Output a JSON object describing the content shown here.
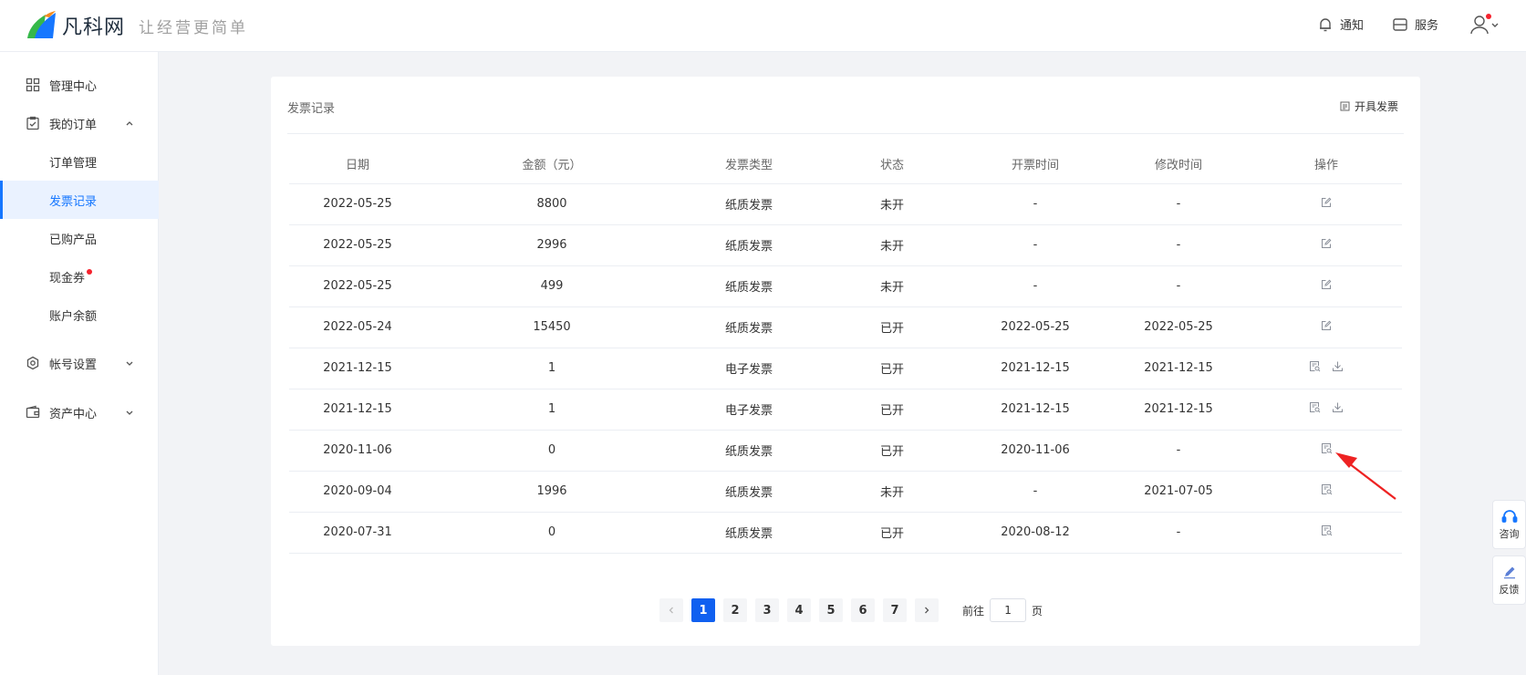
{
  "header": {
    "brand": "凡科网",
    "slogan": "让经营更简单",
    "notify_label": "通知",
    "service_label": "服务",
    "brand_colors": {
      "green": "#36b84a",
      "blue": "#1677ff",
      "orange": "#f38b1f"
    }
  },
  "sidebar": {
    "items": [
      {
        "label": "管理中心",
        "icon": "grid-icon"
      },
      {
        "label": "我的订单",
        "icon": "clipboard-check-icon",
        "expanded": true
      },
      {
        "label": "帐号设置",
        "icon": "settings-icon",
        "expanded": false
      },
      {
        "label": "资产中心",
        "icon": "wallet-icon",
        "expanded": false
      }
    ],
    "sub_items": [
      {
        "label": "订单管理"
      },
      {
        "label": "发票记录",
        "active": true
      },
      {
        "label": "已购产品"
      },
      {
        "label": "现金券",
        "badge": true
      },
      {
        "label": "账户余额"
      }
    ]
  },
  "card": {
    "title": "发票记录",
    "issue_button": "开具发票"
  },
  "table": {
    "headers": [
      "日期",
      "金额（元）",
      "发票类型",
      "状态",
      "开票时间",
      "修改时间",
      "操作"
    ],
    "rows": [
      {
        "date": "2022-05-25",
        "amount": "8800",
        "type": "纸质发票",
        "status": "未开",
        "issued": "-",
        "modified": "-",
        "actions": [
          "edit"
        ]
      },
      {
        "date": "2022-05-25",
        "amount": "2996",
        "type": "纸质发票",
        "status": "未开",
        "issued": "-",
        "modified": "-",
        "actions": [
          "edit"
        ]
      },
      {
        "date": "2022-05-25",
        "amount": "499",
        "type": "纸质发票",
        "status": "未开",
        "issued": "-",
        "modified": "-",
        "actions": [
          "edit"
        ]
      },
      {
        "date": "2022-05-24",
        "amount": "15450",
        "type": "纸质发票",
        "status": "已开",
        "issued": "2022-05-25",
        "modified": "2022-05-25",
        "actions": [
          "edit"
        ]
      },
      {
        "date": "2021-12-15",
        "amount": "1",
        "type": "电子发票",
        "status": "已开",
        "issued": "2021-12-15",
        "modified": "2021-12-15",
        "actions": [
          "view",
          "download"
        ]
      },
      {
        "date": "2021-12-15",
        "amount": "1",
        "type": "电子发票",
        "status": "已开",
        "issued": "2021-12-15",
        "modified": "2021-12-15",
        "actions": [
          "view",
          "download"
        ]
      },
      {
        "date": "2020-11-06",
        "amount": "0",
        "type": "纸质发票",
        "status": "已开",
        "issued": "2020-11-06",
        "modified": "-",
        "actions": [
          "view"
        ]
      },
      {
        "date": "2020-09-04",
        "amount": "1996",
        "type": "纸质发票",
        "status": "未开",
        "issued": "-",
        "modified": "2021-07-05",
        "actions": [
          "view"
        ]
      },
      {
        "date": "2020-07-31",
        "amount": "0",
        "type": "纸质发票",
        "status": "已开",
        "issued": "2020-08-12",
        "modified": "-",
        "actions": [
          "view"
        ]
      }
    ]
  },
  "pagination": {
    "pages": [
      "1",
      "2",
      "3",
      "4",
      "5",
      "6",
      "7"
    ],
    "current": "1",
    "goto_prefix": "前往",
    "goto_value": "1",
    "goto_suffix": "页",
    "prev_icon": "chevron-left-icon",
    "next_icon": "chevron-right-icon"
  },
  "float": {
    "consult_label": "咨询",
    "feedback_label": "反馈"
  },
  "annotation": {
    "color": "#ee2222"
  }
}
